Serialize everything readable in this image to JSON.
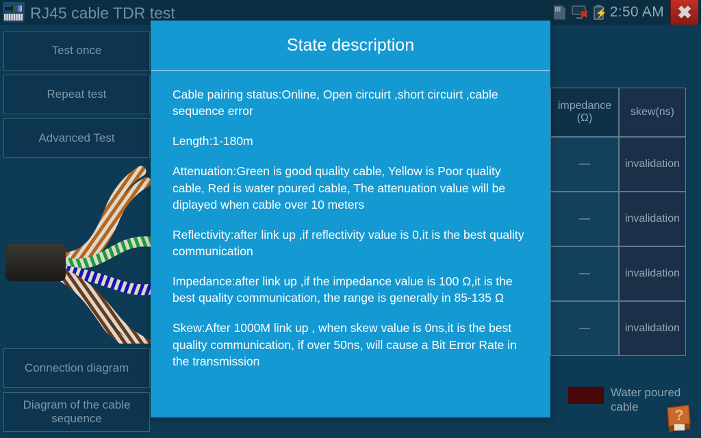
{
  "window": {
    "title": "RJ45 cable TDR test",
    "app_icon": "rj45-connector-icon",
    "close_label": "✖"
  },
  "status_bar": {
    "sd_icon": "sd-card-icon",
    "network_icon": "network-disconnected-icon",
    "battery_icon": "battery-charging-icon",
    "battery_glyph": "⚡",
    "time": "2:50 AM"
  },
  "sidebar": {
    "buttons": [
      {
        "id": "test-once",
        "label": "Test once"
      },
      {
        "id": "repeat-test",
        "label": "Repeat test"
      },
      {
        "id": "advanced-test",
        "label": "Advanced Test"
      },
      {
        "id": "connection-diagram",
        "label": "Connection diagram"
      },
      {
        "id": "cable-sequence-diagram",
        "label": "Diagram of the cable sequence"
      }
    ],
    "cable_image_alt": "rj45-cable-twisted-pairs"
  },
  "results_table": {
    "headers": [
      "impedance (Ω)",
      "skew(ns)"
    ],
    "header_impedance_line1": "impedance",
    "header_impedance_line2": "(Ω)",
    "header_skew": "skew(ns)",
    "rows": [
      {
        "impedance": "—",
        "skew": "invalidation"
      },
      {
        "impedance": "—",
        "skew": "invalidation"
      },
      {
        "impedance": "—",
        "skew": "invalidation"
      },
      {
        "impedance": "—",
        "skew": "invalidation"
      }
    ]
  },
  "legend": {
    "swatch_color": "#450707",
    "label": "Water poured cable"
  },
  "help_button": {
    "icon": "help-book-icon",
    "glyph": "?"
  },
  "dialog": {
    "title": "State description",
    "paragraphs": [
      "Cable pairing status:Online, Open circuirt ,short circuirt ,cable sequence error",
      "Length:1-180m",
      "Attenuation:Green is good quality cable, Yellow is Poor quality cable, Red is water poured cable, The attenuation value will be diplayed when cable over 10 meters",
      "Reflectivity:after link up ,if reflectivity value is 0,it is the best quality communication",
      "Impedance:after link up ,if the impedance value is 100 Ω,it is the best quality communication, the range is generally in 85-135 Ω",
      "Skew:After 1000M link up  , when skew value is 0ns,it is the best quality communication, if over 50ns, will cause a Bit Error Rate in the transmission"
    ]
  },
  "colors": {
    "background": "#0d3a54",
    "titlebar": "#0c2e42",
    "dialog_accent": "#1499d3",
    "close_red": "#c03026",
    "table_border": "#5d7a8b"
  }
}
